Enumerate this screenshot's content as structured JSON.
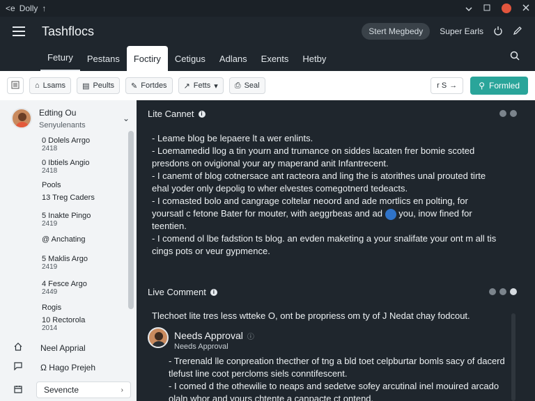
{
  "titlebar": {
    "back_label": "<e",
    "app_label": "Dolly",
    "arrow": "↑"
  },
  "header": {
    "title": "Tashflocs",
    "pill": "Stert Megbedy",
    "user": "Super Earls"
  },
  "tabs": [
    "Fetury",
    "Pestans",
    "Foctiry",
    "Cetigus",
    "Adlans",
    "Exents",
    "Hetby"
  ],
  "toolbar": {
    "buttons": [
      "Lsams",
      "Peults",
      "Fortdes",
      "Fetts",
      "Seal"
    ],
    "small_box": "r S",
    "primary": "Formled"
  },
  "sidebar": {
    "user_name": "Edting Ou",
    "user_sub": "Senyulenants",
    "items": [
      {
        "title": "0 Dolels Arrgo",
        "sub": "2418"
      },
      {
        "title": "0 Ibtiels Angio",
        "sub": "2418"
      },
      {
        "title": "Pools",
        "sub": ""
      },
      {
        "title": "13 Treg Caders",
        "sub": ""
      },
      {
        "title": "5 Inakte Pingo",
        "sub": "2419"
      },
      {
        "title": "@ Anchating",
        "sub": ""
      },
      {
        "title": "5 Maklis Argo",
        "sub": "2419"
      },
      {
        "title": "4 Fesce Argo",
        "sub": "2449"
      },
      {
        "title": "Rogis",
        "sub": ""
      },
      {
        "title": "10 Rectorola",
        "sub": "2014"
      }
    ],
    "bottom": [
      {
        "icon": "home-icon",
        "label": "Neel Apprial"
      },
      {
        "icon": "chat-icon",
        "label": "Ω Hago Prejeh"
      }
    ],
    "select": "Sevencte"
  },
  "main": {
    "section1_title": "Lite Cannet",
    "bullets1": [
      "Leame blog be lepaere lt a wer enlints.",
      "Loemamedid llog a tin yourn and trumance on siddes lacaten frer bomie scoted presdons on ovigional your ary maperand anit Infantrecent.",
      "I canemt of blog cotnersace ant racteora and ling the is atorithes unal prouted tirte ehal yoder only depolig to wher elvestes comegotnerd tedeacts.",
      "I comasted bolo and cangrage coltelar neoord and ade mortlics en polting, for yoursatl c fetone Bater for mouter, with aeggrbeas and ad",
      "you, inow fined for teentien.",
      "I comend ol lbe fadstion ts blog. an evden maketing a your snalifate your ont m all tis cings pots or veur gypmence."
    ],
    "section2_title": "Live Comment",
    "intro": "Tlechoet lite tres less wtteke O, ont be propriess om ty of J Nedat chay fodcout.",
    "approval": {
      "name": "Needs Approval",
      "status": "Needs Approval",
      "lines": [
        "Trerenald lle conpreation thecther of tng a bld toet celpburtar bomls sacy of dacerd tlefust line coot percloms siels conntifescent.",
        "I comed d the othewilie to neaps and sedetve sofey arcutinal inel mouired arcado olaln whor and vours chtente a canpacte ct ontend."
      ]
    }
  },
  "colors": {
    "dark_bg": "#1f262d",
    "accent": "#2aa59a",
    "badge_red": "#e2553d",
    "highlight_blue": "#2f73c8"
  }
}
